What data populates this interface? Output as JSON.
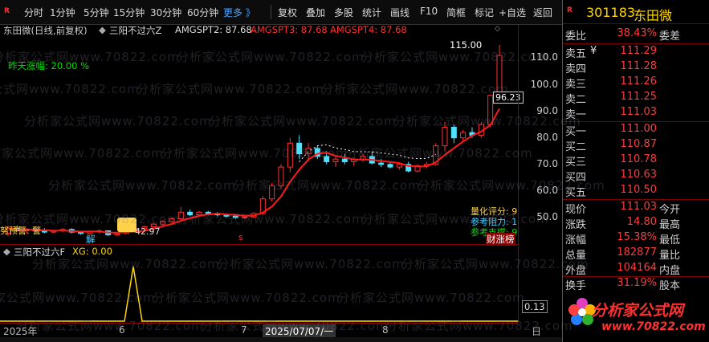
{
  "toolbar": {
    "left_items": [
      "分时",
      "1分钟",
      "5分钟",
      "15分钟",
      "30分钟",
      "60分钟"
    ],
    "more": "更多 》",
    "right_items": [
      "复权",
      "叠加",
      "多股",
      "统计",
      "画线",
      "F10",
      "简框",
      "标记",
      "+自选",
      "返回"
    ]
  },
  "chart_header": {
    "stock_label": "东田微(日线,前复权)",
    "indicator_name": "三阳不过六Z",
    "amg2": "AMGSPT2: 87.68",
    "amg3": "AMGSPT3: 87.68",
    "amg4": "AMGSPT4: 87.68"
  },
  "price_pane": {
    "yesterday_gain": "昨天涨幅:  20.00 %",
    "high_marker": "115.00",
    "price_box": "96.23",
    "low_marker": "42.97",
    "jie_label": "解",
    "left_label": "努预警:  警",
    "s_marker": "s",
    "right_labels": {
      "score": "量化评分:  9",
      "resistance": "参考阻力:  1",
      "support": "参考支撑:  9"
    },
    "caiz_label": "财涨榜",
    "axis_ticks": [
      "110.0",
      "100.0",
      "90.0",
      "80.0",
      "70.0",
      "60.0",
      "50.0"
    ],
    "candle_data": [
      [
        44,
        47,
        43,
        46
      ],
      [
        46,
        47,
        45,
        45
      ],
      [
        45,
        46,
        44,
        45.5
      ],
      [
        45.5,
        46,
        44.5,
        45
      ],
      [
        45,
        46,
        44,
        44.5
      ],
      [
        44.5,
        45.5,
        44,
        45
      ],
      [
        45,
        46,
        44.5,
        45.5
      ],
      [
        45.5,
        46,
        44,
        44.5
      ],
      [
        44.5,
        45,
        43.5,
        44
      ],
      [
        44,
        45,
        43.5,
        44.8
      ],
      [
        44.8,
        45.5,
        44,
        45
      ],
      [
        45,
        45.2,
        43,
        43.5
      ],
      [
        43.5,
        44.5,
        42.97,
        44
      ],
      [
        44,
        45.5,
        43.8,
        45.2
      ],
      [
        45.2,
        46,
        44.5,
        45.8
      ],
      [
        45.8,
        47,
        45.5,
        46.5
      ],
      [
        46.5,
        48,
        46,
        47.5
      ],
      [
        47.5,
        49,
        47,
        48.5
      ],
      [
        48.5,
        50,
        48,
        49.5
      ],
      [
        49.5,
        54,
        49,
        52
      ],
      [
        52,
        53,
        50.5,
        51
      ],
      [
        51,
        52.5,
        50.5,
        52
      ],
      [
        52,
        52.5,
        50.8,
        51.5
      ],
      [
        51.5,
        52,
        50.5,
        51
      ],
      [
        51,
        51.5,
        50,
        50.5
      ],
      [
        50.5,
        51,
        49.5,
        50
      ],
      [
        50,
        50.5,
        49.5,
        50.2
      ],
      [
        50.2,
        52,
        50,
        51.5
      ],
      [
        51.5,
        58,
        51,
        57
      ],
      [
        57,
        63,
        56,
        62
      ],
      [
        62,
        70,
        61,
        69
      ],
      [
        69,
        80,
        67,
        78
      ],
      [
        78,
        81,
        72,
        74
      ],
      [
        74,
        78,
        71,
        76
      ],
      [
        76,
        77,
        72,
        73
      ],
      [
        73,
        75,
        70,
        71
      ],
      [
        71,
        73,
        69,
        72
      ],
      [
        72,
        74,
        70,
        71
      ],
      [
        71,
        72.5,
        69.5,
        72
      ],
      [
        72,
        74,
        71,
        73
      ],
      [
        73,
        75,
        70,
        70.5
      ],
      [
        70.5,
        72,
        69,
        70
      ],
      [
        70,
        71,
        68.5,
        69
      ],
      [
        69,
        70.5,
        68,
        70
      ],
      [
        70,
        71,
        67,
        67.5
      ],
      [
        67.5,
        70,
        67,
        69.5
      ],
      [
        69.5,
        71,
        68.5,
        70
      ],
      [
        70,
        78,
        69.5,
        77
      ],
      [
        77,
        86,
        75,
        84
      ],
      [
        84,
        85,
        78,
        80
      ],
      [
        80,
        83,
        79,
        82
      ],
      [
        82,
        84,
        80,
        81
      ],
      [
        81,
        86,
        80,
        85
      ],
      [
        85,
        96.23,
        84,
        96
      ],
      [
        96,
        115,
        95,
        111.03
      ]
    ],
    "ma_label": ""
  },
  "indicator_pane": {
    "title": "三阳不过六F",
    "xg": "XG: 0.00",
    "axis_value": "0.13"
  },
  "dates": {
    "year": "2025年",
    "m6": "6",
    "m7": "7",
    "cursor_date": "2025/07/07/一",
    "m8": "8",
    "right": "日"
  },
  "right_panel": {
    "code": "301183",
    "name": "东田微",
    "wei_bi_label": "委比",
    "wei_bi": "38.43%",
    "wei_cha_label": "委差",
    "sells": [
      {
        "label": "卖五",
        "price": "111.29"
      },
      {
        "label": "卖四",
        "price": "111.28"
      },
      {
        "label": "卖三",
        "price": "111.26"
      },
      {
        "label": "卖二",
        "price": "111.25"
      },
      {
        "label": "卖一",
        "price": "111.03"
      }
    ],
    "buys": [
      {
        "label": "买一",
        "price": "111.00"
      },
      {
        "label": "买二",
        "price": "110.87"
      },
      {
        "label": "买三",
        "price": "110.78"
      },
      {
        "label": "买四",
        "price": "110.63"
      },
      {
        "label": "买五",
        "price": "110.50"
      }
    ],
    "stats": [
      {
        "label": "现价",
        "value": "111.03",
        "label2": "今开"
      },
      {
        "label": "涨跌",
        "value": "14.80",
        "label2": "最高"
      },
      {
        "label": "涨幅",
        "value": "15.38%",
        "label2": "最低"
      },
      {
        "label": "总量",
        "value": "182877",
        "label2": "量比"
      },
      {
        "label": "外盘",
        "value": "104164",
        "label2": "内盘"
      },
      {
        "label": "换手",
        "value": "31.19%",
        "label2": "股本"
      }
    ],
    "yen": "¥",
    "brand": "分析家公式网",
    "brand_url": "www.70822.com"
  },
  "watermark": "分析家公式网www.70822.com"
}
